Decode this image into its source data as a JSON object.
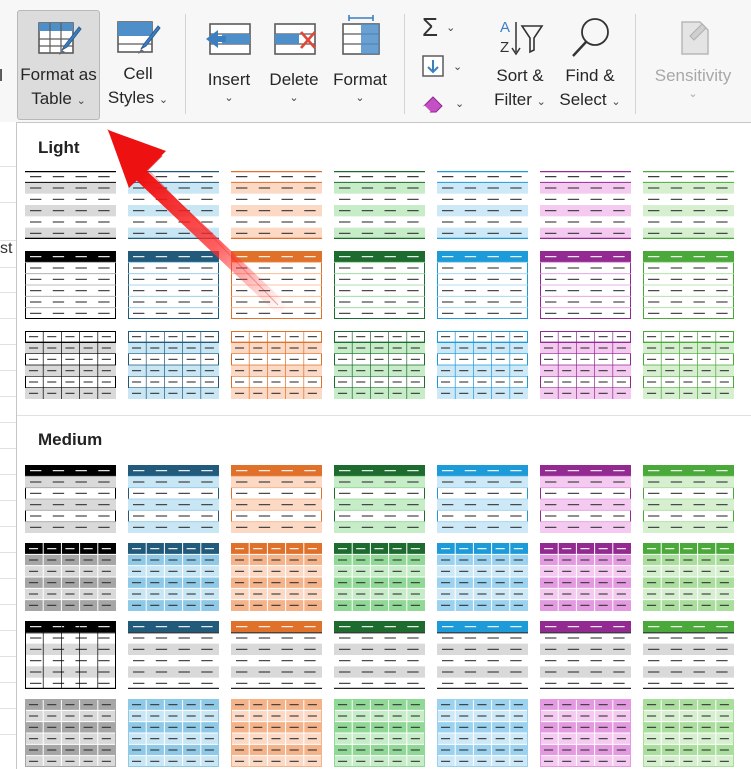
{
  "ribbon": {
    "format_as_table": {
      "line1": "Format as",
      "line2": "Table"
    },
    "cell_styles": {
      "line1": "Cell",
      "line2": "Styles"
    },
    "insert": {
      "label": "Insert"
    },
    "delete": {
      "label": "Delete"
    },
    "format": {
      "label": "Format"
    },
    "sort_filter": {
      "line1": "Sort &",
      "line2": "Filter"
    },
    "find_select": {
      "line1": "Find &",
      "line2": "Select"
    },
    "sensitivity": {
      "label": "Sensitivity"
    },
    "partial_left_label": "l",
    "sheet_partial_text": "st"
  },
  "gallery": {
    "sections": [
      {
        "title": "Light"
      },
      {
        "title": "Medium"
      }
    ],
    "colors": {
      "black": {
        "dark": "#000000",
        "light": "#d9d9d9",
        "mid": "#a6a6a6"
      },
      "blue": {
        "dark": "#215a7b",
        "light": "#c9e6f4",
        "mid": "#8fc9e8"
      },
      "orange": {
        "dark": "#e0712b",
        "light": "#fbd9c4",
        "mid": "#f5b38a"
      },
      "green": {
        "dark": "#1e6b30",
        "light": "#c6ecc8",
        "mid": "#8fd895"
      },
      "cyan": {
        "dark": "#1d9bd8",
        "light": "#cde9f7",
        "mid": "#9ad2f0"
      },
      "purple": {
        "dark": "#932a92",
        "light": "#f4caf1",
        "mid": "#e49ae0"
      },
      "lime": {
        "dark": "#4aa93a",
        "light": "#d6f0cf",
        "mid": "#a9de9c"
      }
    },
    "color_order": [
      "black",
      "blue",
      "orange",
      "green",
      "cyan",
      "purple",
      "lime"
    ],
    "rows": [
      {
        "section": 0,
        "variant": "light-banded"
      },
      {
        "section": 0,
        "variant": "light-header"
      },
      {
        "section": 0,
        "variant": "light-grid"
      },
      {
        "section": 1,
        "variant": "medium-header-banded"
      },
      {
        "section": 1,
        "variant": "medium-grid-banded"
      },
      {
        "section": 1,
        "variant": "medium-plain"
      },
      {
        "section": 1,
        "variant": "medium-full-grid"
      }
    ]
  }
}
